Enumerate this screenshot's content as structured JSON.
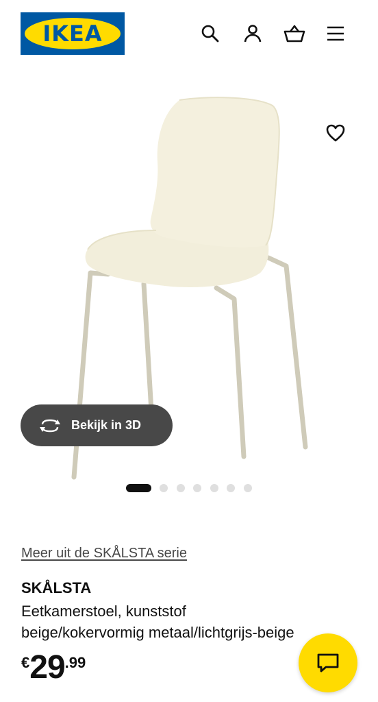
{
  "header": {
    "logo_text": "IKEA",
    "icons": [
      "search-icon",
      "account-icon",
      "basket-icon",
      "menu-icon"
    ]
  },
  "gallery": {
    "view_3d_label": "Bekijk in 3D",
    "dots_total": 7,
    "dots_active_index": 0
  },
  "product": {
    "series_link": "Meer uit de SKÅLSTA serie",
    "name": "SKÅLSTA",
    "description_line1": "Eetkamerstoel, kunststof",
    "description_line2": "beige/kokervormig metaal/lichtgrijs-beige",
    "price": {
      "currency": "€",
      "integer": "29",
      "decimals": ".99"
    }
  },
  "colors": {
    "brand_blue": "#0058a3",
    "brand_yellow": "#ffdb00",
    "button_dark": "#484848",
    "chair_shell": "#f3efdc",
    "chair_legs": "#cfcbb9"
  }
}
